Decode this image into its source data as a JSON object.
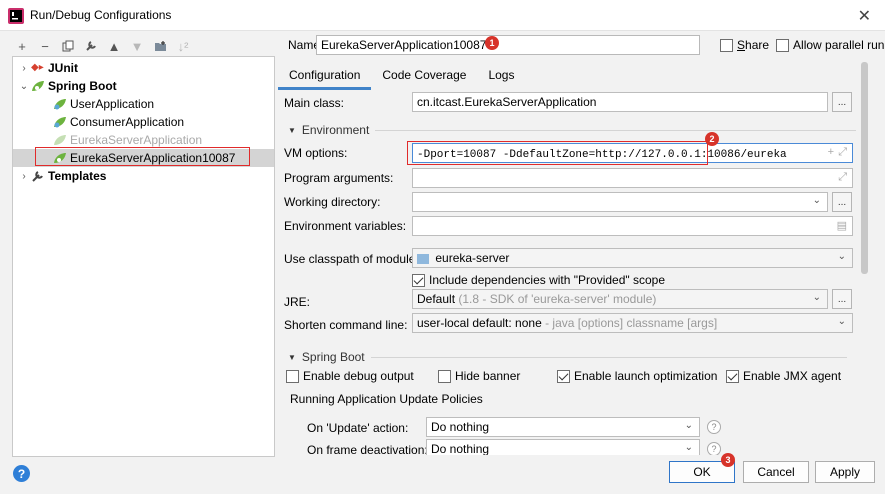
{
  "window": {
    "title": "Run/Debug Configurations",
    "close_icon": "close-icon"
  },
  "toolbar": {
    "icons": [
      "add-icon",
      "remove-icon",
      "copy-icon",
      "wrench-icon",
      "move-up-icon",
      "move-down-icon",
      "folder-icon",
      "sort-icon"
    ]
  },
  "tree": {
    "junit": "JUnit",
    "spring_boot": "Spring Boot",
    "items": [
      "UserApplication",
      "ConsumerApplication",
      "EurekaServerApplication",
      "EurekaServerApplication10087"
    ],
    "templates": "Templates"
  },
  "header": {
    "name_label": "Name:",
    "name_value": "EurekaServerApplication10087",
    "share_label": "Share",
    "share_mnemonic_rest": "hare",
    "share_mnemonic": "S",
    "parallel_label": "Allow parallel run"
  },
  "badges": [
    "1",
    "2",
    "3"
  ],
  "tabs": [
    "Configuration",
    "Code Coverage",
    "Logs"
  ],
  "config": {
    "main_class_label": "Main class:",
    "main_class_value": "cn.itcast.EurekaServerApplication",
    "environment_header": "Environment",
    "vm_options_label": "VM options:",
    "vm_options_value": "-Dport=10087 -DdefaultZone=http://127.0.0.1:10086/eureka",
    "program_args_label": "Program arguments:",
    "working_dir_label": "Working directory:",
    "env_vars_label": "Environment variables:",
    "classpath_label": "Use classpath of module:",
    "classpath_value": "eureka-server",
    "include_deps_label": "Include dependencies with \"Provided\" scope",
    "jre_label": "JRE:",
    "jre_value": "Default",
    "jre_hint": "(1.8 - SDK of 'eureka-server' module)",
    "shorten_label": "Shorten command line:",
    "shorten_value": "user-local default: none",
    "shorten_hint": "- java [options] classname [args]",
    "spring_boot_header": "Spring Boot",
    "debug_output_label": "Enable debug output",
    "hide_banner_label": "Hide banner",
    "launch_opt_label": "Enable launch optimization",
    "jmx_label": "Enable JMX agent",
    "policies_header": "Running Application Update Policies",
    "on_update_label": "On 'Update' action:",
    "on_update_value": "Do nothing",
    "on_frame_label": "On frame deactivation:",
    "on_frame_value": "Do nothing",
    "browse_label": "...",
    "help_q": "?"
  },
  "footer": {
    "ok": "OK",
    "cancel": "Cancel",
    "apply": "Apply",
    "help": "?"
  },
  "colors": {
    "accent": "#4083c9",
    "badge": "#d7332a",
    "highlight": "#e02b2b"
  }
}
